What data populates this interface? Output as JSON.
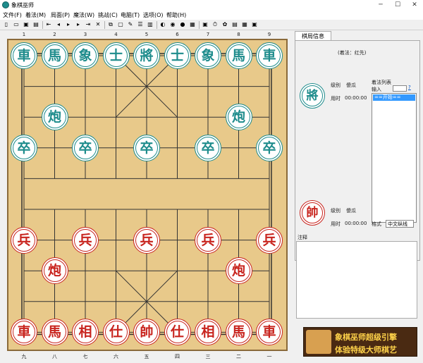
{
  "window": {
    "title": "象棋巫师",
    "min": "─",
    "max": "☐",
    "close": "✕"
  },
  "menu": [
    "文件(F)",
    "着法(M)",
    "局面(P)",
    "魔法(W)",
    "挑战(C)",
    "电脑(T)",
    "选项(O)",
    "帮助(H)"
  ],
  "toolbar_icons": [
    "new-icon",
    "open-icon",
    "save-icon",
    "save-as-icon",
    "first-move-icon",
    "prev-move-icon",
    "play-icon",
    "next-move-icon",
    "last-move-icon",
    "delete-icon",
    "copy-icon",
    "clear-icon",
    "edit-icon",
    "list-icon",
    "book-icon",
    "color-icon",
    "eye-icon",
    "record-icon",
    "note-icon",
    "computer-icon",
    "timer-icon",
    "sound-icon",
    "chart-icon",
    "window-icon",
    "exit-icon"
  ],
  "toolbar_glyphs": [
    "▯",
    "▭",
    "▣",
    "▤",
    "⇤",
    "◂",
    "▸",
    "▸",
    "⇥",
    "✕",
    "⧉",
    "▢",
    "✎",
    "☰",
    "▥",
    "◐",
    "◉",
    "●",
    "▦",
    "▣",
    "⏱",
    "✿",
    "▤",
    "▦",
    "▣"
  ],
  "board": {
    "top_file_numbers": [
      "1",
      "2",
      "3",
      "4",
      "5",
      "6",
      "7",
      "8",
      "9"
    ],
    "bottom_file_numbers": [
      "九",
      "八",
      "七",
      "六",
      "五",
      "四",
      "三",
      "二",
      "一"
    ],
    "black_pieces": [
      {
        "ch": "車"
      },
      {
        "ch": "馬"
      },
      {
        "ch": "象"
      },
      {
        "ch": "士"
      },
      {
        "ch": "將"
      },
      {
        "ch": "士"
      },
      {
        "ch": "象"
      },
      {
        "ch": "馬"
      },
      {
        "ch": "車"
      },
      {
        "ch": "炮"
      },
      {
        "ch": "炮"
      },
      {
        "ch": "卒"
      },
      {
        "ch": "卒"
      },
      {
        "ch": "卒"
      },
      {
        "ch": "卒"
      },
      {
        "ch": "卒"
      }
    ],
    "red_pieces": [
      {
        "ch": "兵"
      },
      {
        "ch": "兵"
      },
      {
        "ch": "兵"
      },
      {
        "ch": "兵"
      },
      {
        "ch": "兵"
      },
      {
        "ch": "炮"
      },
      {
        "ch": "炮"
      },
      {
        "ch": "車"
      },
      {
        "ch": "馬"
      },
      {
        "ch": "相"
      },
      {
        "ch": "仕"
      },
      {
        "ch": "帥"
      },
      {
        "ch": "仕"
      },
      {
        "ch": "相"
      },
      {
        "ch": "馬"
      },
      {
        "ch": "車"
      }
    ]
  },
  "panel": {
    "tab": "棋局信息",
    "turn_info": "(着法：红先)",
    "black_general": "將",
    "red_general": "帥",
    "level_label": "级别",
    "level_value_top": "傻瓜",
    "time_label": "用时",
    "time_value_top": "00:00:00",
    "level_value_bottom": "傻瓜",
    "time_value_bottom": "00:00:00",
    "movelist_title": "着法列表",
    "input_label": "输入",
    "help_link": "?",
    "start_item": "==开始==",
    "format_label": "格式",
    "format_value": "中文纵线",
    "comment_label": "注释"
  },
  "banner": {
    "line1": "象棋巫师超级引擎",
    "line2": "体验特级大师棋艺"
  },
  "colors": {
    "black_piece": "#1e8c8c",
    "red_piece": "#c8241e",
    "board": "#e8c98a"
  }
}
